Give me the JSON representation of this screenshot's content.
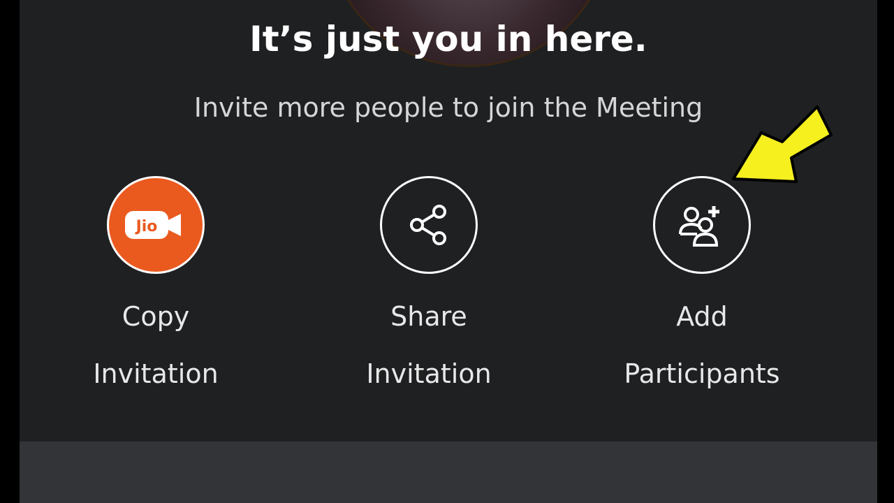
{
  "meeting": {
    "title": "It’s just you in here.",
    "subtitle": "Invite more people to join the Meeting"
  },
  "actions": [
    {
      "line1": "Copy",
      "line2": "Invitation",
      "icon": "jio-meet-logo-icon",
      "icon_text": "Jio"
    },
    {
      "line1": "Share",
      "line2": "Invitation",
      "icon": "share-icon"
    },
    {
      "line1": "Add",
      "line2": "Participants",
      "icon": "add-participants-icon"
    }
  ],
  "colors": {
    "background": "#1f2022",
    "brand_orange": "#ea5a1f",
    "highlight_arrow": "#f5f01e",
    "bottom_bar": "#333438"
  }
}
